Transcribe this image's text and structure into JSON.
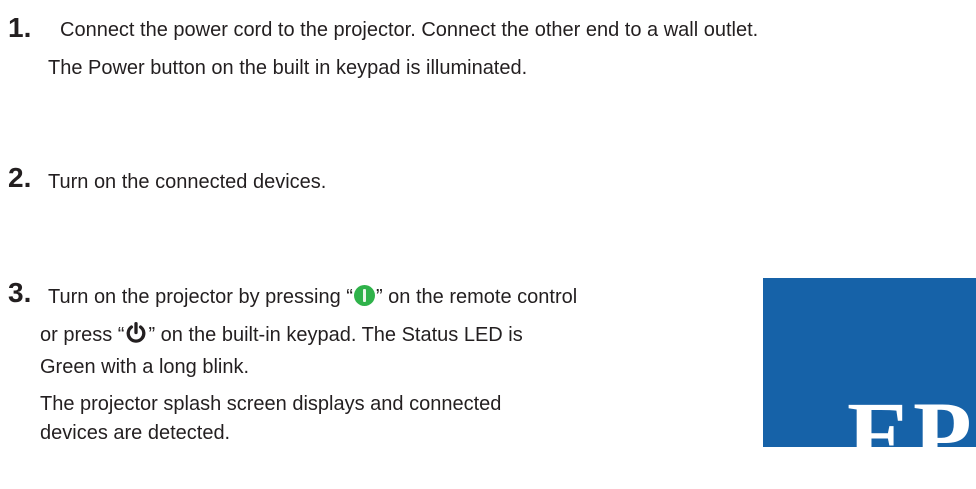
{
  "steps": [
    {
      "number": "1.",
      "lines": [
        "Connect the power cord to the projector. Connect the other end to a wall outlet.",
        "The Power button on the built in keypad is illuminated."
      ]
    },
    {
      "number": "2.",
      "lines": [
        "Turn on the connected devices."
      ]
    },
    {
      "number": "3.",
      "line1_before": "Turn on the projector by pressing “",
      "line1_after": "” on the remote control",
      "line2_before": "or press “",
      "line2_after": "” on the built-in keypad. The Status LED is",
      "line3": "Green with a long blink.",
      "line4": "The projector splash screen displays and connected",
      "line5": "devices are detected."
    }
  ],
  "splash_screen": {
    "text": "EP",
    "background_color": "#1662a8"
  },
  "icons": {
    "remote_power": "power-green-icon",
    "keypad_power": "power-icon"
  }
}
